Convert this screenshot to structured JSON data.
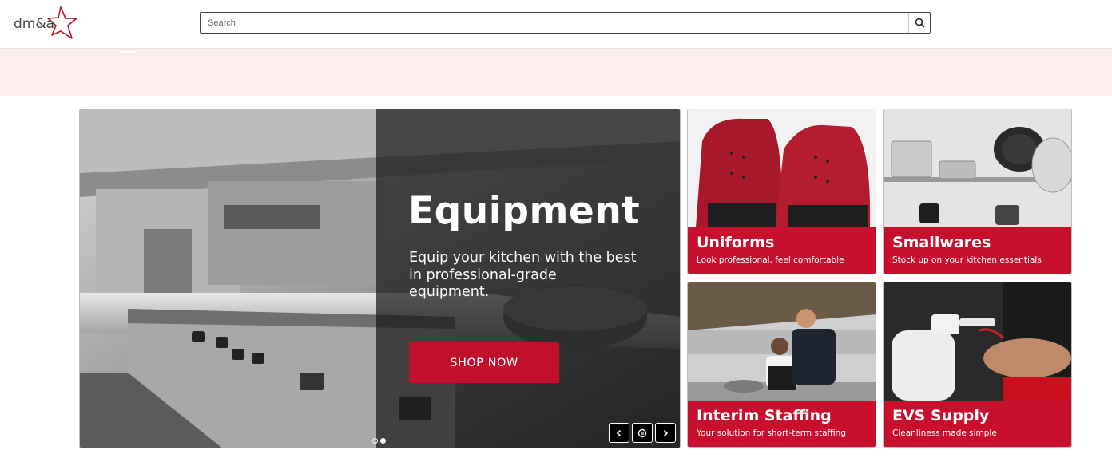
{
  "header": {
    "logo_text": "dm&a",
    "search": {
      "placeholder": "Search",
      "value": ""
    }
  },
  "hero": {
    "title": "Equipment",
    "subtitle": "Equip your kitchen with the best in professional-grade equipment.",
    "cta_label": "SHOP NOW",
    "slide_count": 2,
    "active_slide": 2
  },
  "tiles": [
    {
      "title": "Uniforms",
      "subtitle": "Look professional, feel comfortable"
    },
    {
      "title": "Smallwares",
      "subtitle": "Stock up on your kitchen essentials"
    },
    {
      "title": "Interim Staffing",
      "subtitle": "Your solution for short-term staffing"
    },
    {
      "title": "EVS Supply",
      "subtitle": "Cleanliness made simple"
    }
  ],
  "colors": {
    "brand_red": "#c8102e",
    "band_pink": "#fdeeee",
    "dark_overlay": "#181818"
  },
  "icons": {
    "search": "search-icon",
    "prev": "chevron-left-icon",
    "pause": "pause-icon",
    "next": "chevron-right-icon"
  }
}
